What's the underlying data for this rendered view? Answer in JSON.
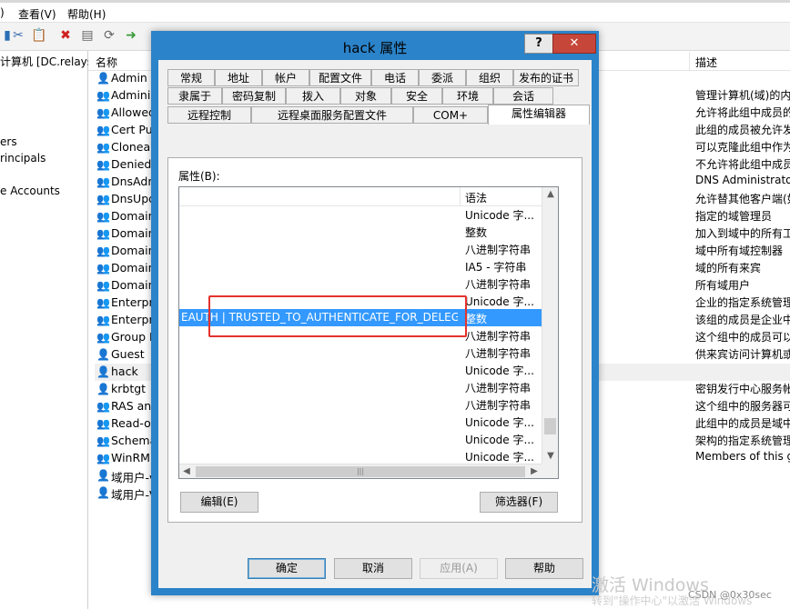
{
  "menubar": {
    "prefix": ")",
    "view": "查看(V)",
    "help": "帮助(H)"
  },
  "tree": {
    "items": [
      "计算机 [DC.relays",
      "ers",
      "rincipals",
      "e Accounts"
    ]
  },
  "list": {
    "col_name": "名称",
    "col_desc": "描述",
    "rows": [
      {
        "name": "Admin",
        "type": "user"
      },
      {
        "name": "Adminis",
        "type": "group"
      },
      {
        "name": "Allowed",
        "type": "group"
      },
      {
        "name": "Cert Pul",
        "type": "group"
      },
      {
        "name": "Cloneab",
        "type": "group"
      },
      {
        "name": "Denied",
        "type": "group"
      },
      {
        "name": "DnsAdm",
        "type": "group"
      },
      {
        "name": "DnsUpd",
        "type": "group"
      },
      {
        "name": "Domain",
        "type": "group"
      },
      {
        "name": "Domain",
        "type": "group"
      },
      {
        "name": "Domain",
        "type": "group"
      },
      {
        "name": "Domain",
        "type": "group"
      },
      {
        "name": "Domain",
        "type": "group"
      },
      {
        "name": "Enterpr",
        "type": "group"
      },
      {
        "name": "Enterpr",
        "type": "group"
      },
      {
        "name": "Group P",
        "type": "group"
      },
      {
        "name": "Guest",
        "type": "user"
      },
      {
        "name": "hack",
        "type": "user"
      },
      {
        "name": "krbtgt",
        "type": "user"
      },
      {
        "name": "RAS and",
        "type": "group"
      },
      {
        "name": "Read-o",
        "type": "group"
      },
      {
        "name": "Schema",
        "type": "group"
      },
      {
        "name": "WinRMI",
        "type": "group"
      },
      {
        "name": "域用户-v",
        "type": "user"
      },
      {
        "name": "域用户-V",
        "type": "user"
      }
    ],
    "descriptions": [
      "管理计算机(域)的内",
      "允许将此组中成员的",
      "此组的成员被允许发",
      "可以克隆此组中作为",
      "不允许将此组中成员",
      "DNS Administrato",
      "允许替其他客户端(如",
      "指定的域管理员",
      "加入到域中的所有工",
      "域中所有域控制器",
      "域的所有来宾",
      "所有域用户",
      "企业的指定系统管理",
      "该组的成员是企业中",
      "这个组中的成员可以",
      "供来宾访问计算机或",
      "",
      "密钥发行中心服务帐",
      "这个组中的服务器可",
      "此组中的成员是域中",
      "架构的指定系统管理",
      "Members of this g"
    ]
  },
  "dialog": {
    "title": "hack 属性",
    "help_label": "?",
    "close_label": "✕",
    "tabs_row1": [
      "常规",
      "地址",
      "帐户",
      "配置文件",
      "电话",
      "委派",
      "组织",
      "发布的证书"
    ],
    "tabs_row2": [
      "隶属于",
      "密码复制",
      "拨入",
      "对象",
      "安全",
      "环境",
      "会话"
    ],
    "tabs_row3": [
      "远程控制",
      "远程桌面服务配置文件",
      "COM+",
      "属性编辑器"
    ],
    "attr_label": "属性(B):",
    "syntax_header": "语法",
    "rows": [
      {
        "value": "",
        "syntax": "Unicode 字..."
      },
      {
        "value": "",
        "syntax": "整数"
      },
      {
        "value": "",
        "syntax": "八进制字符串"
      },
      {
        "value": "",
        "syntax": "IA5 - 字符串"
      },
      {
        "value": "",
        "syntax": "八进制字符串"
      },
      {
        "value": "",
        "syntax": "Unicode 字..."
      },
      {
        "value": "EAUTH | TRUSTED_TO_AUTHENTICATE_FOR_DELEG...",
        "syntax": "整数",
        "selected": true
      },
      {
        "value": "",
        "syntax": "八进制字符串"
      },
      {
        "value": "",
        "syntax": "八进制字符串"
      },
      {
        "value": "",
        "syntax": "Unicode 字..."
      },
      {
        "value": "",
        "syntax": "八进制字符串"
      },
      {
        "value": "",
        "syntax": "八进制字符串"
      },
      {
        "value": "",
        "syntax": "Unicode 字..."
      },
      {
        "value": "",
        "syntax": "Unicode 字..."
      },
      {
        "value": "",
        "syntax": "Unicode 字..."
      }
    ],
    "edit_button": "编辑(E)",
    "filter_button": "筛选器(F)",
    "ok_button": "确定",
    "cancel_button": "取消",
    "apply_button": "应用(A)",
    "help_button": "帮助"
  },
  "watermark": {
    "line1": "激活 Windows",
    "line2": "转到\"操作中心\"以激活 Windows",
    "csdn": "CSDN @0x30sec"
  }
}
